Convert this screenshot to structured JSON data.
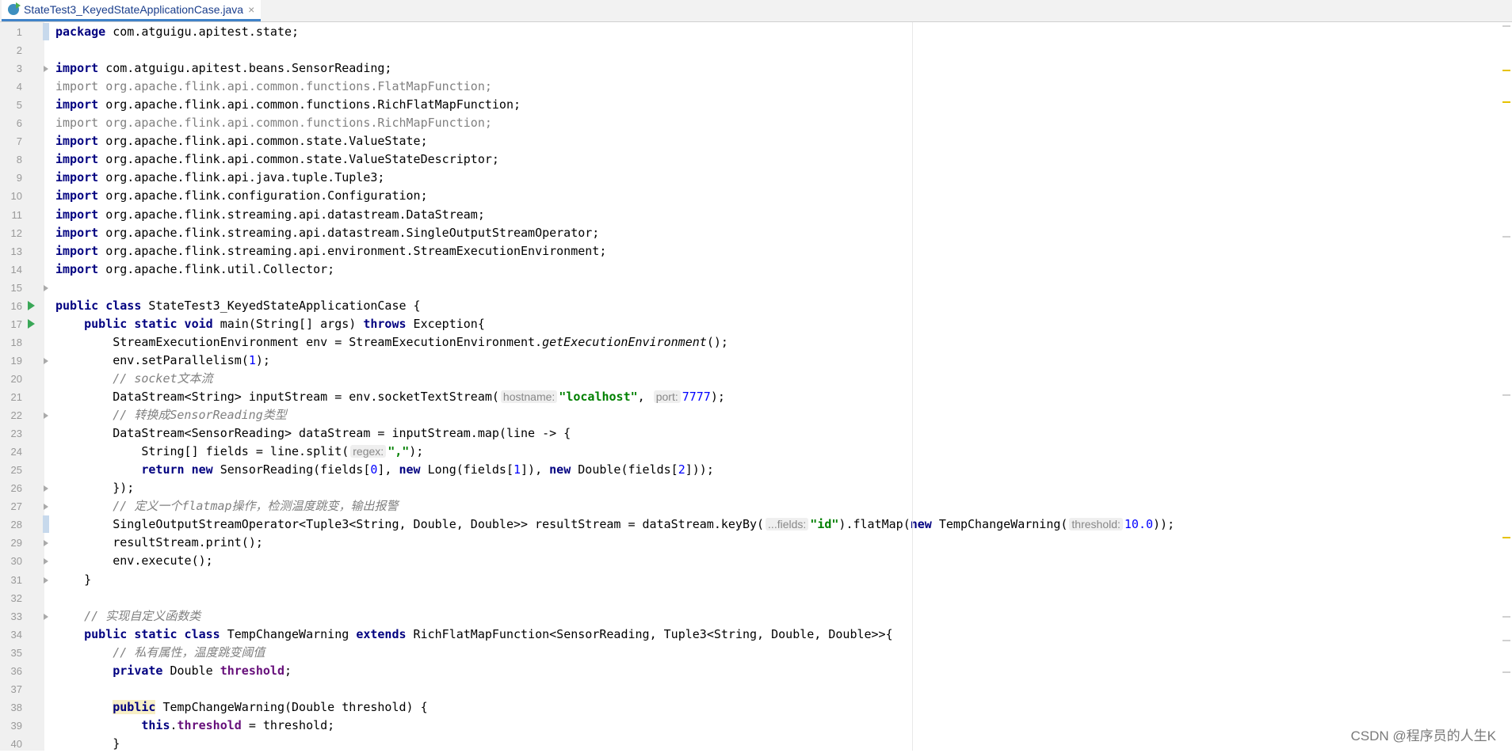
{
  "tab": {
    "title": "StateTest3_KeyedStateApplicationCase.java",
    "close": "×"
  },
  "watermark": "CSDN @程序员的人生K",
  "lines": [
    [
      [
        "kw",
        "package"
      ],
      [
        "p",
        " com.atguigu.apitest.state;"
      ]
    ],
    [],
    [
      [
        "kw",
        "import"
      ],
      [
        "p",
        " com.atguigu.apitest.beans.SensorReading;"
      ]
    ],
    [
      [
        "gray",
        "import org.apache.flink.api.common.functions.FlatMapFunction;"
      ]
    ],
    [
      [
        "kw",
        "import"
      ],
      [
        "p",
        " org.apache.flink.api.common.functions.RichFlatMapFunction;"
      ]
    ],
    [
      [
        "gray",
        "import org.apache.flink.api.common.functions.RichMapFunction;"
      ]
    ],
    [
      [
        "kw",
        "import"
      ],
      [
        "p",
        " org.apache.flink.api.common.state.ValueState;"
      ]
    ],
    [
      [
        "kw",
        "import"
      ],
      [
        "p",
        " org.apache.flink.api.common.state.ValueStateDescriptor;"
      ]
    ],
    [
      [
        "kw",
        "import"
      ],
      [
        "p",
        " org.apache.flink.api.java.tuple.Tuple3;"
      ]
    ],
    [
      [
        "kw",
        "import"
      ],
      [
        "p",
        " org.apache.flink.configuration.Configuration;"
      ]
    ],
    [
      [
        "kw",
        "import"
      ],
      [
        "p",
        " org.apache.flink.streaming.api.datastream.DataStream;"
      ]
    ],
    [
      [
        "kw",
        "import"
      ],
      [
        "p",
        " org.apache.flink.streaming.api.datastream.SingleOutputStreamOperator;"
      ]
    ],
    [
      [
        "kw",
        "import"
      ],
      [
        "p",
        " org.apache.flink.streaming.api.environment.StreamExecutionEnvironment;"
      ]
    ],
    [
      [
        "kw",
        "import"
      ],
      [
        "p",
        " org.apache.flink.util.Collector;"
      ]
    ],
    [],
    [
      [
        "kw",
        "public class"
      ],
      [
        "p",
        " StateTest3_KeyedStateApplicationCase {"
      ]
    ],
    [
      [
        "p",
        "    "
      ],
      [
        "kw",
        "public static void"
      ],
      [
        "p",
        " main(String[] args) "
      ],
      [
        "kw",
        "throws"
      ],
      [
        "p",
        " Exception{"
      ]
    ],
    [
      [
        "p",
        "        StreamExecutionEnvironment env = StreamExecutionEnvironment."
      ],
      [
        "ital",
        "getExecutionEnvironment"
      ],
      [
        "p",
        "();"
      ]
    ],
    [
      [
        "p",
        "        env.setParallelism("
      ],
      [
        "num",
        "1"
      ],
      [
        "p",
        ");"
      ]
    ],
    [
      [
        "p",
        "        "
      ],
      [
        "cmt",
        "// socket文本流"
      ]
    ],
    [
      [
        "p",
        "        DataStream<String> inputStream = env.socketTextStream("
      ],
      [
        "hint",
        "hostname:"
      ],
      [
        "str",
        "\"localhost\""
      ],
      [
        "p",
        ", "
      ],
      [
        "hint",
        "port:"
      ],
      [
        "num",
        "7777"
      ],
      [
        "p",
        ");"
      ]
    ],
    [
      [
        "p",
        "        "
      ],
      [
        "cmt",
        "// 转换成SensorReading类型"
      ]
    ],
    [
      [
        "p",
        "        DataStream<SensorReading> dataStream = inputStream.map(line -> {"
      ]
    ],
    [
      [
        "p",
        "            String[] fields = line.split("
      ],
      [
        "hint",
        "regex:"
      ],
      [
        "str",
        "\",\""
      ],
      [
        "p",
        ");"
      ]
    ],
    [
      [
        "p",
        "            "
      ],
      [
        "kw",
        "return new"
      ],
      [
        "p",
        " SensorReading(fields["
      ],
      [
        "num",
        "0"
      ],
      [
        "p",
        "], "
      ],
      [
        "kw",
        "new"
      ],
      [
        "p",
        " Long(fields["
      ],
      [
        "num",
        "1"
      ],
      [
        "p",
        "]), "
      ],
      [
        "kw",
        "new"
      ],
      [
        "p",
        " Double(fields["
      ],
      [
        "num",
        "2"
      ],
      [
        "p",
        "]));"
      ]
    ],
    [
      [
        "p",
        "        });"
      ]
    ],
    [
      [
        "p",
        "        "
      ],
      [
        "cmt",
        "// 定义一个flatmap操作，检测温度跳变，输出报警"
      ]
    ],
    [
      [
        "p",
        "        SingleOutputStreamOperator<Tuple3<String, Double, Double>> resultStream = dataStream.keyBy("
      ],
      [
        "hint",
        "...fields:"
      ],
      [
        "str",
        "\"id\""
      ],
      [
        "p",
        ").flatMap("
      ],
      [
        "kw",
        "new"
      ],
      [
        "p",
        " TempChangeWarning("
      ],
      [
        "hint",
        "threshold:"
      ],
      [
        "num",
        "10.0"
      ],
      [
        "p",
        "));"
      ]
    ],
    [
      [
        "p",
        "        resultStream.print();"
      ]
    ],
    [
      [
        "p",
        "        env.execute();"
      ]
    ],
    [
      [
        "p",
        "    }"
      ]
    ],
    [],
    [
      [
        "p",
        "    "
      ],
      [
        "cmt",
        "// 实现自定义函数类"
      ]
    ],
    [
      [
        "p",
        "    "
      ],
      [
        "kw",
        "public static class"
      ],
      [
        "p",
        " TempChangeWarning "
      ],
      [
        "kw",
        "extends"
      ],
      [
        "p",
        " RichFlatMapFunction<SensorReading, Tuple3<String, Double, Double>>{"
      ]
    ],
    [
      [
        "p",
        "        "
      ],
      [
        "cmt",
        "// 私有属性，温度跳变阈值"
      ]
    ],
    [
      [
        "p",
        "        "
      ],
      [
        "kw",
        "private"
      ],
      [
        "p",
        " Double "
      ],
      [
        "fld",
        "threshold"
      ],
      [
        "p",
        ";"
      ]
    ],
    [],
    [
      [
        "p",
        "        "
      ],
      [
        "kwhl",
        "public"
      ],
      [
        "p",
        " TempChangeWarning(Double threshold) {"
      ]
    ],
    [
      [
        "p",
        "            "
      ],
      [
        "kw",
        "this"
      ],
      [
        "p",
        "."
      ],
      [
        "fld",
        "threshold"
      ],
      [
        "p",
        " = threshold;"
      ]
    ],
    [
      [
        "p",
        "        }"
      ]
    ]
  ]
}
